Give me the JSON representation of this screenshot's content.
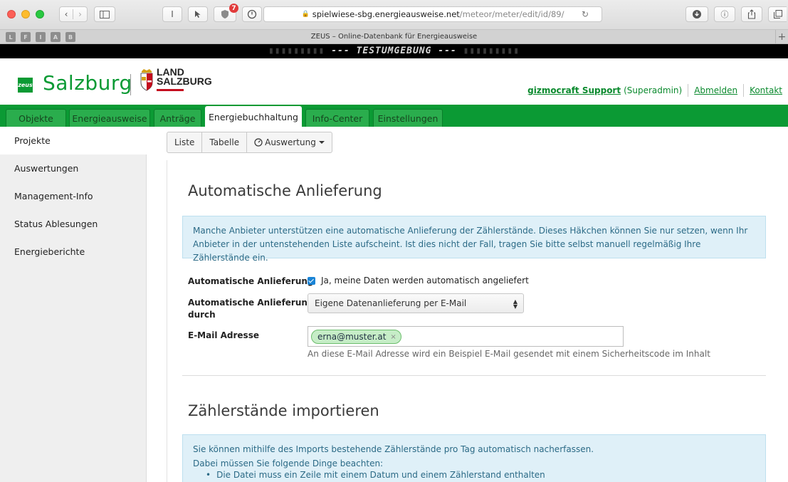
{
  "browser": {
    "url_host": "spielwiese-sbg.energieausweise.net",
    "url_path": "/meteor/meter/edit/id/89/",
    "reader_label": "I",
    "notification_count": "7",
    "tab_title": "ZEUS – Online-Datenbank für Energieausweise",
    "favorites": [
      "L",
      "F",
      "I",
      "A",
      "B"
    ]
  },
  "banner": {
    "dots_left": "▮▮▮▮▮▮▮▮▮",
    "text": "--- TESTUMGEBUNG ---",
    "dots_right": "▮▮▮▮▮▮▮▮▮"
  },
  "header": {
    "logo_mark": "zeus",
    "logo_text": "Salzburg",
    "land_line1": "LAND",
    "land_line2": "SALZBURG",
    "user_name": "gizmocraft Support",
    "user_role": "(Superadmin)",
    "logout": "Abmelden",
    "contact": "Kontakt"
  },
  "nav": {
    "tabs": [
      {
        "label": "Objekte"
      },
      {
        "label": "Energieausweise"
      },
      {
        "label": "Anträge"
      },
      {
        "label": "Energiebuchhaltung"
      },
      {
        "label": "Info-Center"
      },
      {
        "label": "Einstellungen"
      }
    ],
    "active_index": 3
  },
  "sidebar": {
    "items": [
      {
        "label": "Projekte"
      },
      {
        "label": "Auswertungen"
      },
      {
        "label": "Management-Info"
      },
      {
        "label": "Status Ablesungen"
      },
      {
        "label": "Energieberichte"
      }
    ]
  },
  "subtoolbar": {
    "list": "Liste",
    "table": "Tabelle",
    "evaluation": "Auswertung"
  },
  "section1": {
    "title": "Automatische Anlieferung",
    "info": "Manche Anbieter unterstützen eine automatische Anlieferung der Zählerstände. Dieses Häkchen können Sie nur setzen, wenn Ihr Anbieter in der untenstehenden Liste aufscheint. Ist dies nicht der Fall, tragen Sie bitte selbst manuell regelmäßig Ihre Zählerstände ein.",
    "auto_label": "Automatische Anlieferung",
    "auto_checkbox_text": "Ja, meine Daten werden automatisch angeliefert",
    "auto_checked": true,
    "by_label_1": "Automatische Anlieferung",
    "by_label_2": "durch",
    "by_value": "Eigene Datenanlieferung per E-Mail",
    "email_label": "E-Mail Adresse",
    "email_tag": "erna@muster.at",
    "email_help": "An diese E-Mail Adresse wird ein Beispiel E-Mail gesendet mit einem Sicherheitscode im Inhalt"
  },
  "section2": {
    "title": "Zählerstände importieren",
    "line1": "Sie können mithilfe des Imports bestehende Zählerstände pro Tag automatisch nacherfassen.",
    "line2": "Dabei müssen Sie folgende Dinge beachten:",
    "bullets": [
      "Die Datei muss ein Zeile mit einem Datum und einem Zählerstand enthalten"
    ]
  },
  "colors": {
    "brand_green": "#0b9a34",
    "info_bg": "#dff0f8",
    "info_text": "#2b6a86"
  }
}
